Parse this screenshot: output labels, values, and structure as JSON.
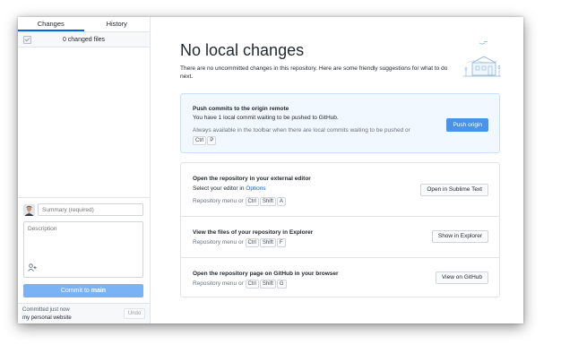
{
  "sidebar": {
    "tabs": [
      {
        "label": "Changes"
      },
      {
        "label": "History"
      }
    ],
    "changed_files": "0 changed files",
    "commit": {
      "summary_placeholder": "Summary (required)",
      "description_placeholder": "Description",
      "button_prefix": "Commit to ",
      "branch": "main"
    },
    "last_commit": {
      "time": "Committed just now",
      "message": "my personal website",
      "undo_label": "Undo"
    }
  },
  "main": {
    "title": "No local changes",
    "subtitle": "There are no uncommitted changes in this repository. Here are some friendly suggestions for what to do next.",
    "push": {
      "title": "Push commits to the origin remote",
      "text": "You have 1 local commit waiting to be pushed to GitHub.",
      "hint": "Always available in the toolbar when there are local commits waiting to be pushed or",
      "keys": [
        "Ctrl",
        "P"
      ],
      "button": "Push origin"
    },
    "editor": {
      "title": "Open the repository in your external editor",
      "text": "Select your editor in ",
      "link": "Options",
      "hint": "Repository menu or",
      "keys": [
        "Ctrl",
        "Shift",
        "A"
      ],
      "button": "Open in Sublime Text"
    },
    "explorer": {
      "title": "View the files of your repository in Explorer",
      "hint": "Repository menu or",
      "keys": [
        "Ctrl",
        "Shift",
        "F"
      ],
      "button": "Show in Explorer"
    },
    "github": {
      "title": "Open the repository page on GitHub in your browser",
      "hint": "Repository menu or",
      "keys": [
        "Ctrl",
        "Shift",
        "G"
      ],
      "button": "View on GitHub"
    }
  },
  "colors": {
    "accent": "#0366d6",
    "commit_button": "#79b3f5",
    "push_button": "#4a93e8",
    "push_card_bg": "#f1f8ff"
  }
}
